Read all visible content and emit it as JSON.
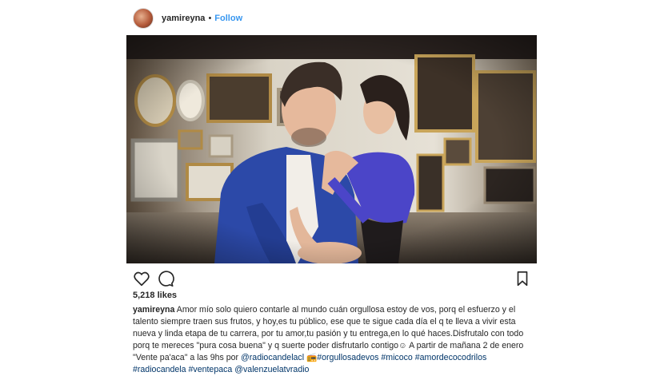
{
  "post": {
    "username": "yamireyna",
    "separator": "•",
    "follow_label": "Follow",
    "likes": "5,218 likes"
  },
  "photo": {
    "description_icon": "couple-photo-image"
  },
  "icons": {
    "like": "heart-icon",
    "comment": "comment-bubble-icon",
    "save": "bookmark-icon"
  },
  "caption": {
    "username": "yamireyna",
    "text1": "Amor mío solo quiero contarle al mundo cuán orgullosa estoy de vos, porq el esfuerzo y el talento siempre traen sus frutos, y hoy,es tu público, ese que te sigue cada día el q te lleva a vivir esta nueva y linda etapa de tu carrera, por tu amor,tu pasión y tu entrega,en lo qué haces.Disfrutalo con todo porq te mereces \"pura cosa buena\" y q suerte poder disfrutarlo contigo☺ A partir de mañana 2 de enero \"Vente pa'aca\" a las 9hs por",
    "mention1": "@radiocandelacl",
    "emoji": "📻",
    "tag1": "#orgullosadevos",
    "tag2": "#micoco",
    "tag3": "#amordecocodrilos",
    "tag4": "#radiocandela",
    "tag5": "#ventepaca",
    "mention2": "@valenzuelatvradio"
  },
  "colors": {
    "link": "#003569",
    "follow": "#3897f0",
    "text": "#262626"
  }
}
